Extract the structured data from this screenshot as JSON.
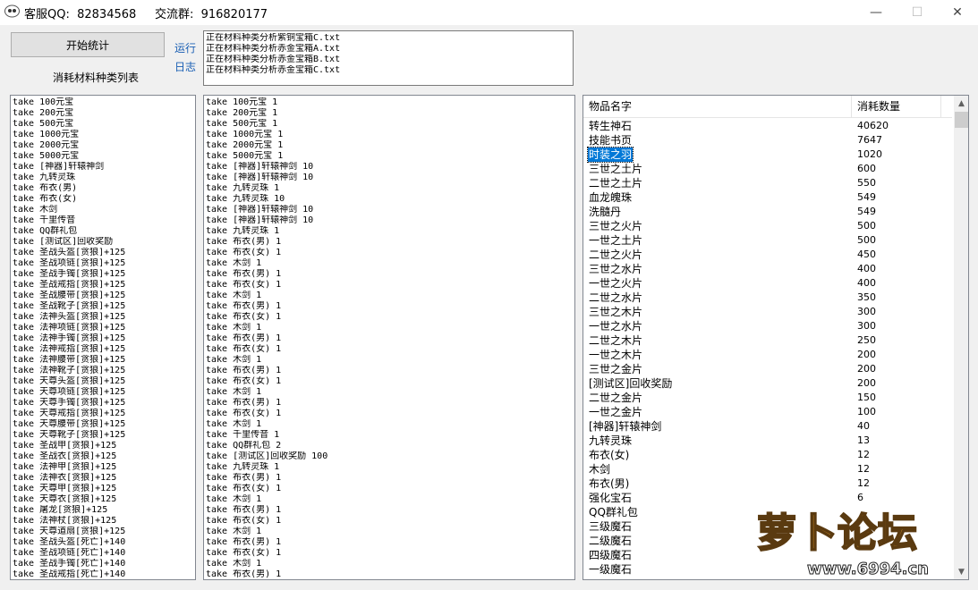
{
  "window": {
    "title": "客服QQ:  82834568     交流群:  916820177",
    "minimize": "—",
    "maximize": "☐",
    "close": "✕"
  },
  "toolbar": {
    "start_label": "开始统计",
    "run_label": "运行",
    "log_label": "日志",
    "list_title": "消耗材料种类列表"
  },
  "log_lines": [
    "正在材料种类分析紫铜宝箱C.txt",
    "正在材料种类分析赤金宝箱A.txt",
    "正在材料种类分析赤金宝箱B.txt",
    "正在材料种类分析赤金宝箱C.txt"
  ],
  "left_list": [
    "take 100元宝",
    "take 200元宝",
    "take 500元宝",
    "take 1000元宝",
    "take 2000元宝",
    "take 5000元宝",
    "take [神器]轩辕神剑",
    "take 九转灵珠",
    "take 布衣(男)",
    "take 布衣(女)",
    "take 木剑",
    "take 千里传音",
    "take QQ群礼包",
    "take [测试区]回收奖励",
    "take 圣战头盔[贪狼]+125",
    "take 圣战项链[贪狼]+125",
    "take 圣战手镯[贪狼]+125",
    "take 圣战戒指[贪狼]+125",
    "take 圣战腰带[贪狼]+125",
    "take 圣战靴子[贪狼]+125",
    "take 法神头盔[贪狼]+125",
    "take 法神项链[贪狼]+125",
    "take 法神手镯[贪狼]+125",
    "take 法神戒指[贪狼]+125",
    "take 法神腰带[贪狼]+125",
    "take 法神靴子[贪狼]+125",
    "take 天尊头盔[贪狼]+125",
    "take 天尊项链[贪狼]+125",
    "take 天尊手镯[贪狼]+125",
    "take 天尊戒指[贪狼]+125",
    "take 天尊腰带[贪狼]+125",
    "take 天尊靴子[贪狼]+125",
    "take 圣战甲[贪狼]+125",
    "take 圣战衣[贪狼]+125",
    "take 法神甲[贪狼]+125",
    "take 法神衣[贪狼]+125",
    "take 天尊甲[贪狼]+125",
    "take 天尊衣[贪狼]+125",
    "take 屠龙[贪狼]+125",
    "take 法神杖[贪狼]+125",
    "take 天尊道扇[贪狼]+125",
    "take 圣战头盔[死亡]+140",
    "take 圣战项链[死亡]+140",
    "take 圣战手镯[死亡]+140",
    "take 圣战戒指[死亡]+140"
  ],
  "mid_list": [
    "take 100元宝 1",
    "take 200元宝 1",
    "take 500元宝 1",
    "take 1000元宝 1",
    "take 2000元宝 1",
    "take 5000元宝 1",
    "take [神器]轩辕神剑 10",
    "take [神器]轩辕神剑 10",
    "take 九转灵珠 1",
    "take 九转灵珠 10",
    "take [神器]轩辕神剑 10",
    "take [神器]轩辕神剑 10",
    "take 九转灵珠 1",
    "take 布衣(男) 1",
    "take 布衣(女) 1",
    "take 木剑 1",
    "take 布衣(男) 1",
    "take 布衣(女) 1",
    "take 木剑 1",
    "take 布衣(男) 1",
    "take 布衣(女) 1",
    "take 木剑 1",
    "take 布衣(男) 1",
    "take 布衣(女) 1",
    "take 木剑 1",
    "take 布衣(男) 1",
    "take 布衣(女) 1",
    "take 木剑 1",
    "take 布衣(男) 1",
    "take 布衣(女) 1",
    "take 木剑 1",
    "take 千里传音 1",
    "take QQ群礼包 2",
    "take [测试区]回收奖励 100",
    "take 九转灵珠 1",
    "take 布衣(男) 1",
    "take 布衣(女) 1",
    "take 木剑 1",
    "take 布衣(男) 1",
    "take 布衣(女) 1",
    "take 木剑 1",
    "take 布衣(男) 1",
    "take 布衣(女) 1",
    "take 木剑 1",
    "take 布衣(男) 1"
  ],
  "listview": {
    "col_name": "物品名字",
    "col_count": "消耗数量",
    "rows": [
      {
        "name": "转生神石",
        "count": "40620"
      },
      {
        "name": "技能书页",
        "count": "7647"
      },
      {
        "name": "时装之羽",
        "count": "1020",
        "selected": true
      },
      {
        "name": "三世之土片",
        "count": "600"
      },
      {
        "name": "二世之土片",
        "count": "550"
      },
      {
        "name": "血龙魄珠",
        "count": "549"
      },
      {
        "name": "洗髓丹",
        "count": "549"
      },
      {
        "name": "三世之火片",
        "count": "500"
      },
      {
        "name": "一世之土片",
        "count": "500"
      },
      {
        "name": "二世之火片",
        "count": "450"
      },
      {
        "name": "三世之水片",
        "count": "400"
      },
      {
        "name": "一世之火片",
        "count": "400"
      },
      {
        "name": "二世之水片",
        "count": "350"
      },
      {
        "name": "三世之木片",
        "count": "300"
      },
      {
        "name": "一世之水片",
        "count": "300"
      },
      {
        "name": "二世之木片",
        "count": "250"
      },
      {
        "name": "一世之木片",
        "count": "200"
      },
      {
        "name": "三世之金片",
        "count": "200"
      },
      {
        "name": "[测试区]回收奖励",
        "count": "200"
      },
      {
        "name": "二世之金片",
        "count": "150"
      },
      {
        "name": "一世之金片",
        "count": "100"
      },
      {
        "name": "[神器]轩辕神剑",
        "count": "40"
      },
      {
        "name": "九转灵珠",
        "count": "13"
      },
      {
        "name": "布衣(女)",
        "count": "12"
      },
      {
        "name": "木剑",
        "count": "12"
      },
      {
        "name": "布衣(男)",
        "count": "12"
      },
      {
        "name": "强化宝石",
        "count": "6"
      },
      {
        "name": "QQ群礼包",
        "count": ""
      },
      {
        "name": "三级魔石",
        "count": ""
      },
      {
        "name": "二级魔石",
        "count": ""
      },
      {
        "name": "四级魔石",
        "count": ""
      },
      {
        "name": "一级魔石",
        "count": "3"
      }
    ]
  },
  "watermark": {
    "title": "萝卜论坛",
    "url": "www.6994.cn"
  },
  "colors": {
    "accent": "#0078d7",
    "link": "#1a5fb4",
    "window_bg": "#f0f0f0"
  }
}
